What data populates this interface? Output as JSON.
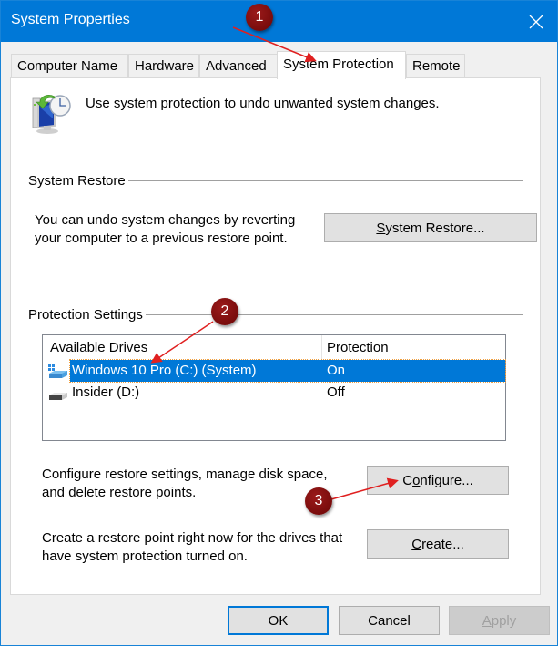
{
  "window": {
    "title": "System Properties"
  },
  "tabs": [
    {
      "label": "Computer Name",
      "active": false
    },
    {
      "label": "Hardware",
      "active": false
    },
    {
      "label": "Advanced",
      "active": false
    },
    {
      "label": "System Protection",
      "active": true
    },
    {
      "label": "Remote",
      "active": false
    }
  ],
  "intro": {
    "icon": "system-restore-icon",
    "text": "Use system protection to undo unwanted system changes."
  },
  "system_restore": {
    "group_label": "System Restore",
    "description_line1": "You can undo system changes by reverting",
    "description_line2": "your computer to a previous restore point.",
    "button_label_underlined": "S",
    "button_label_rest": "ystem Restore..."
  },
  "protection_settings": {
    "group_label": "Protection Settings",
    "columns": [
      "Available Drives",
      "Protection"
    ],
    "drives": [
      {
        "name": "Windows 10 Pro (C:) (System)",
        "protection": "On",
        "icon": "windows-system-drive-icon",
        "selected": true
      },
      {
        "name": "Insider (D:)",
        "protection": "Off",
        "icon": "hard-drive-icon",
        "selected": false
      }
    ],
    "configure_description_line1": "Configure restore settings, manage disk space,",
    "configure_description_line2": "and delete restore points.",
    "configure_label_before": "C",
    "configure_label_underlined": "o",
    "configure_label_after": "nfigure...",
    "create_description_line1": "Create a restore point right now for the drives that",
    "create_description_line2": "have system protection turned on.",
    "create_label_underlined": "C",
    "create_label_rest": "reate..."
  },
  "footer": {
    "ok_label": "OK",
    "cancel_label": "Cancel",
    "apply_label_underlined": "A",
    "apply_label_rest": "pply"
  },
  "annotations": [
    {
      "number": "1",
      "target": "System Protection tab"
    },
    {
      "number": "2",
      "target": "Windows 10 Pro (C:) (System) drive"
    },
    {
      "number": "3",
      "target": "Configure... button"
    }
  ],
  "colors": {
    "titlebar": "#0078d7",
    "selection": "#0078d7",
    "badge": "#7a0c0c",
    "arrow": "#e02020"
  }
}
